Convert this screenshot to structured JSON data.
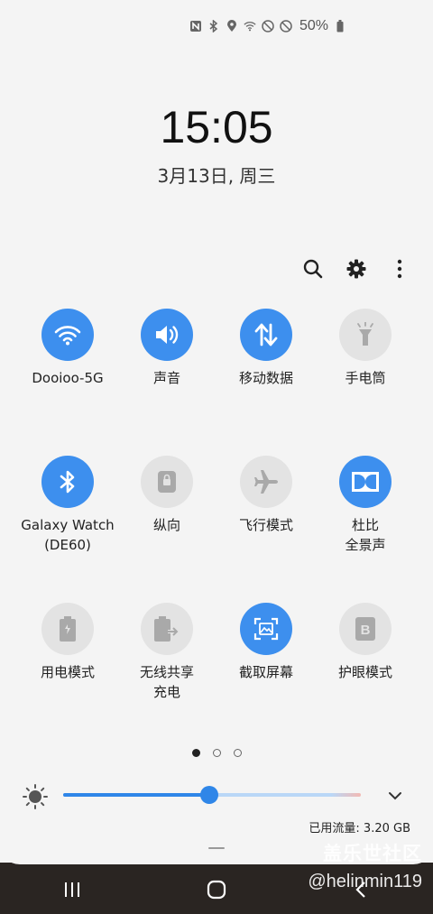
{
  "status_bar": {
    "icons": [
      "nfc-icon",
      "bluetooth-icon",
      "location-icon",
      "wifi-icon",
      "no-disturb-icon",
      "blocked-icon"
    ],
    "battery_percent": "50%"
  },
  "lock": {
    "time": "15:05",
    "date": "3月13日, 周三"
  },
  "toolbar": {
    "icons": [
      "search-icon",
      "settings-icon",
      "more-icon"
    ]
  },
  "tiles": [
    [
      {
        "label": "Dooioo-5G",
        "icon": "wifi-icon",
        "on": true
      },
      {
        "label": "声音",
        "icon": "volume-icon",
        "on": true
      },
      {
        "label": "移动数据",
        "icon": "mobile-data-icon",
        "on": true
      },
      {
        "label": "手电筒",
        "icon": "flashlight-icon",
        "on": false
      }
    ],
    [
      {
        "label": "Galaxy Watch\n(DE60)",
        "icon": "bluetooth-icon",
        "on": true
      },
      {
        "label": "纵向",
        "icon": "rotation-lock-icon",
        "on": false
      },
      {
        "label": "飞行模式",
        "icon": "airplane-icon",
        "on": false
      },
      {
        "label": "杜比\n全景声",
        "icon": "dolby-icon",
        "on": true
      }
    ],
    [
      {
        "label": "用电模式",
        "icon": "power-mode-icon",
        "on": false
      },
      {
        "label": "无线共享\n充电",
        "icon": "wireless-share-icon",
        "on": false
      },
      {
        "label": "截取屏幕",
        "icon": "screenshot-icon",
        "on": true
      },
      {
        "label": "护眼模式",
        "icon": "eye-comfort-icon",
        "on": false
      }
    ]
  ],
  "pager": {
    "pages": 3,
    "active": 0
  },
  "brightness": {
    "level_percent": 49
  },
  "data_usage": "已用流量: 3.20 GB",
  "colors": {
    "accent": "#3d8fee",
    "tile_off": "#e3e3e3"
  },
  "watermark": {
    "logo": "盖乐世社区",
    "user": "@helinmin119"
  },
  "nav": {
    "icons": [
      "recents-icon",
      "home-icon",
      "back-icon"
    ]
  }
}
